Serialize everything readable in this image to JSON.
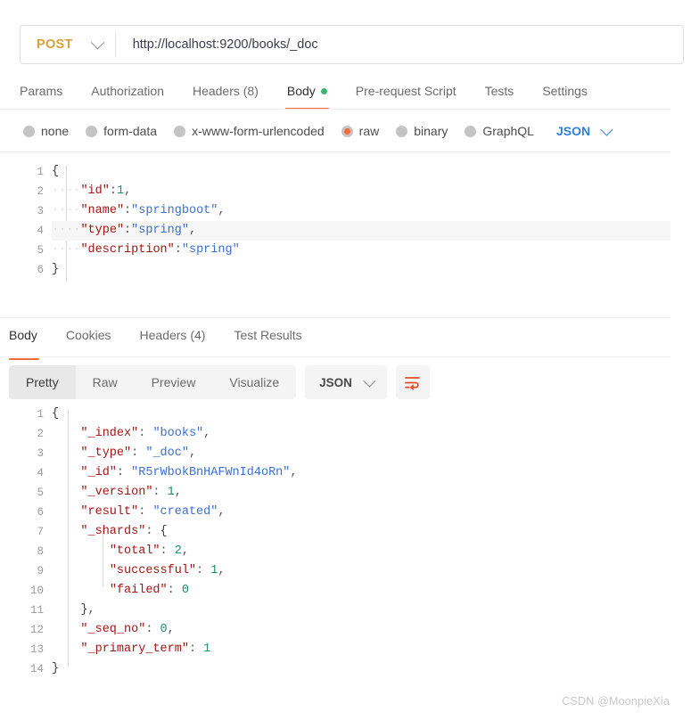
{
  "request": {
    "method": "POST",
    "url": "http://localhost:9200/books/_doc",
    "tabs": [
      {
        "label": "Params",
        "active": false
      },
      {
        "label": "Authorization",
        "active": false
      },
      {
        "label": "Headers (8)",
        "active": false
      },
      {
        "label": "Body",
        "active": true,
        "dot": true
      },
      {
        "label": "Pre-request Script",
        "active": false
      },
      {
        "label": "Tests",
        "active": false
      },
      {
        "label": "Settings",
        "active": false
      }
    ],
    "body_types": [
      {
        "label": "none",
        "selected": false
      },
      {
        "label": "form-data",
        "selected": false
      },
      {
        "label": "x-www-form-urlencoded",
        "selected": false
      },
      {
        "label": "raw",
        "selected": true
      },
      {
        "label": "binary",
        "selected": false
      },
      {
        "label": "GraphQL",
        "selected": false
      }
    ],
    "raw_format": "JSON",
    "body_lines": [
      {
        "n": "1",
        "text": "{"
      },
      {
        "n": "2",
        "text": "    \"id\":1,"
      },
      {
        "n": "3",
        "text": "    \"name\":\"springboot\","
      },
      {
        "n": "4",
        "text": "    \"type\":\"spring\","
      },
      {
        "n": "5",
        "text": "    \"description\":\"spring\""
      },
      {
        "n": "6",
        "text": "}"
      }
    ],
    "body_json": {
      "id": 1,
      "name": "springboot",
      "type": "spring",
      "description": "spring"
    }
  },
  "response": {
    "tabs": [
      {
        "label": "Body",
        "active": true
      },
      {
        "label": "Cookies",
        "active": false
      },
      {
        "label": "Headers (4)",
        "active": false
      },
      {
        "label": "Test Results",
        "active": false
      }
    ],
    "view_modes": [
      {
        "label": "Pretty",
        "active": true
      },
      {
        "label": "Raw",
        "active": false
      },
      {
        "label": "Preview",
        "active": false
      },
      {
        "label": "Visualize",
        "active": false
      }
    ],
    "format": "JSON",
    "wrap_icon": "word-wrap-icon",
    "body_lines": [
      {
        "n": "1",
        "text": "{"
      },
      {
        "n": "2",
        "text": "    \"_index\": \"books\","
      },
      {
        "n": "3",
        "text": "    \"_type\": \"_doc\","
      },
      {
        "n": "4",
        "text": "    \"_id\": \"R5rWbokBnHAFWnId4oRn\","
      },
      {
        "n": "5",
        "text": "    \"_version\": 1,"
      },
      {
        "n": "6",
        "text": "    \"result\": \"created\","
      },
      {
        "n": "7",
        "text": "    \"_shards\": {"
      },
      {
        "n": "8",
        "text": "        \"total\": 2,"
      },
      {
        "n": "9",
        "text": "        \"successful\": 1,"
      },
      {
        "n": "10",
        "text": "        \"failed\": 0"
      },
      {
        "n": "11",
        "text": "    },"
      },
      {
        "n": "12",
        "text": "    \"_seq_no\": 0,"
      },
      {
        "n": "13",
        "text": "    \"_primary_term\": 1"
      },
      {
        "n": "14",
        "text": "}"
      }
    ],
    "body_json": {
      "_index": "books",
      "_type": "_doc",
      "_id": "R5rWbokBnHAFWnId4oRn",
      "_version": 1,
      "result": "created",
      "_shards": {
        "total": 2,
        "successful": 1,
        "failed": 0
      },
      "_seq_no": 0,
      "_primary_term": 1
    }
  },
  "watermark": "CSDN @MoonpieXia",
  "colors": {
    "accent_orange": "#f26b3a",
    "method_orange": "#d9a03b",
    "json_blue": "#2f7fe0",
    "green_dot": "#3cb371",
    "key_red": "#a31515",
    "string_blue": "#3b6fd4",
    "number_green": "#1a8f6e"
  }
}
